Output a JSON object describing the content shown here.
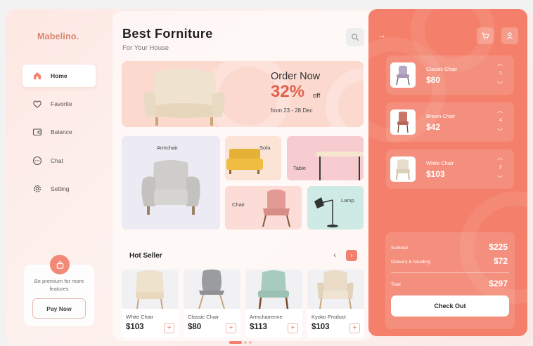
{
  "brand": {
    "logo": "Mabelino.",
    "accent": "#f4806b"
  },
  "sidebar": {
    "items": [
      {
        "label": "Home",
        "icon": "home-icon",
        "active": true
      },
      {
        "label": "Favorite",
        "icon": "heart-icon",
        "active": false
      },
      {
        "label": "Balance",
        "icon": "wallet-icon",
        "active": false
      },
      {
        "label": "Chat",
        "icon": "chat-icon",
        "active": false
      },
      {
        "label": "Setting",
        "icon": "gear-icon",
        "active": false
      }
    ],
    "premium": {
      "text": "Be premium for more features",
      "button": "Pay Now",
      "icon": "bag-icon"
    }
  },
  "header": {
    "title": "Best  Forniture",
    "subtitle": "For Your House",
    "search_icon": "search-icon"
  },
  "banner": {
    "headline": "Order Now",
    "discount": "32%",
    "off": "off",
    "dates": "from 23 - 28 Dec"
  },
  "categories": [
    {
      "label": "Armchair"
    },
    {
      "label": "Sofa"
    },
    {
      "label": "Table"
    },
    {
      "label": "Chair"
    },
    {
      "label": "Lamp"
    }
  ],
  "hot_seller": {
    "title": "Hot Seller",
    "products": [
      {
        "name": "White Chair",
        "price": "$103"
      },
      {
        "name": "Classic Chair",
        "price": "$80"
      },
      {
        "name": "Armchairenne",
        "price": "$113"
      },
      {
        "name": "Kyoko Product",
        "price": "$103"
      }
    ]
  },
  "cart": {
    "items": [
      {
        "name": "Classic Chair",
        "price": "$80",
        "qty": "1"
      },
      {
        "name": "Brown Chair",
        "price": "$42",
        "qty": "4"
      },
      {
        "name": "White Chair",
        "price": "$103",
        "qty": "2"
      }
    ],
    "summary": {
      "subtotal_label": "Subtotal",
      "subtotal": "$225",
      "delivery_label": "Delivery & handling",
      "delivery": "$72",
      "total_label": "Total",
      "total": "$297"
    },
    "checkout": "Check Out"
  }
}
